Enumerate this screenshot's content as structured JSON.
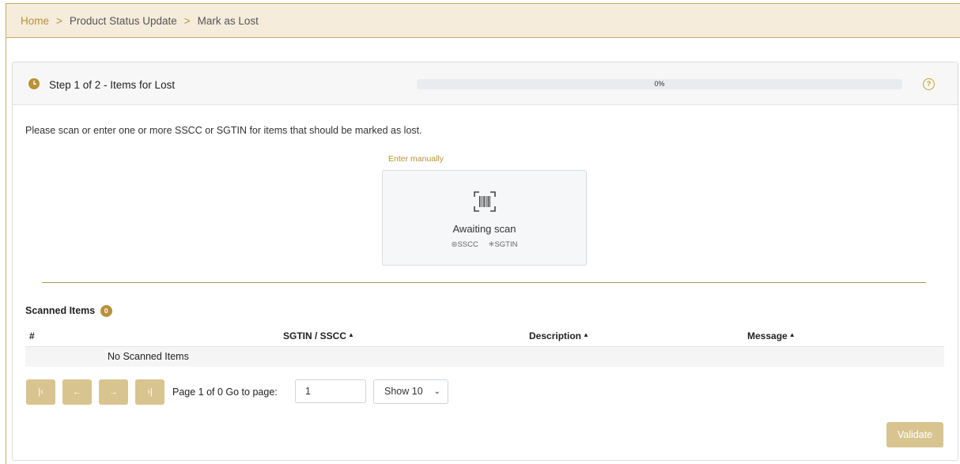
{
  "breadcrumb": {
    "home": "Home",
    "separator": ">",
    "section": "Product Status Update",
    "current": "Mark as Lost"
  },
  "step": {
    "title": "Step 1 of 2 - Items for Lost",
    "progress_percent": 0,
    "progress_text": "0%",
    "help_icon": "?"
  },
  "scan": {
    "instructions": "Please scan or enter one or more SSCC or SGTIN for items that should be marked as lost.",
    "enter_manually": "Enter manually",
    "status": "Awaiting scan",
    "type_sscc": "⊜SSCC",
    "type_sgtin": "✳SGTIN"
  },
  "scanned": {
    "title": "Scanned Items",
    "count": "0",
    "columns": [
      "#",
      "SGTIN / SSCC",
      "Description",
      "Message"
    ],
    "sort_icon": "▲",
    "empty": "No Scanned Items"
  },
  "pager": {
    "first": "|‹",
    "prev": "←",
    "next": "→",
    "last": "›|",
    "page_info": "Page 1 of 0  Go to page:",
    "page_value": "1",
    "show": "Show 10",
    "show_chevron": "⌄"
  },
  "actions": {
    "validate": "Validate"
  },
  "colors": {
    "accent": "#b8913a",
    "button": "#d8c48f",
    "breadcrumb_bg": "#f5ecdc"
  }
}
